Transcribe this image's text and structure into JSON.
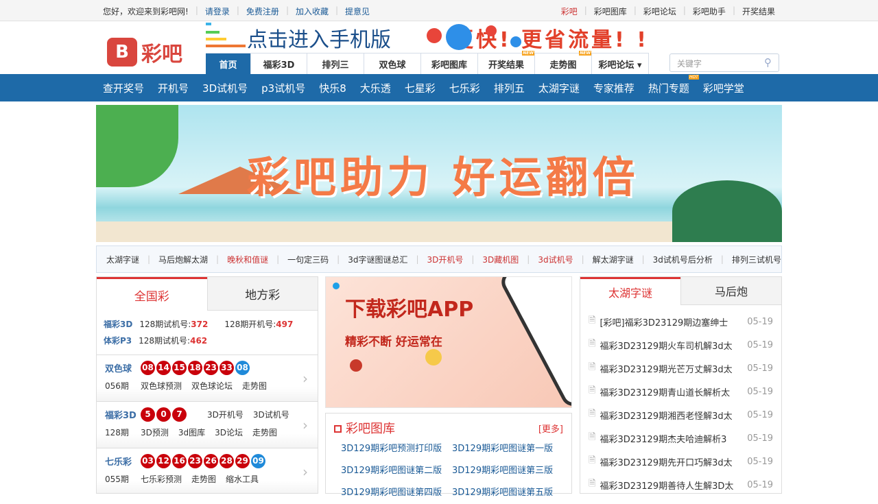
{
  "topbar": {
    "welcome": "您好，欢迎来到彩吧网!",
    "links": [
      "请登录",
      "免费注册",
      "加入收藏",
      "提意见"
    ],
    "right": [
      "彩吧",
      "彩吧图库",
      "彩吧论坛",
      "彩吧助手",
      "开奖结果"
    ]
  },
  "logo": {
    "mark": "B",
    "text": "彩吧"
  },
  "promo": {
    "a": "点击进入手机版",
    "b": "更快! 更省流量! !"
  },
  "mainnav": [
    {
      "label": "首页",
      "badge": ""
    },
    {
      "label": "福彩3D",
      "badge": ""
    },
    {
      "label": "排列三",
      "badge": ""
    },
    {
      "label": "双色球",
      "badge": ""
    },
    {
      "label": "彩吧图库",
      "badge": ""
    },
    {
      "label": "开奖结果",
      "badge": "NEW"
    },
    {
      "label": "走势图",
      "badge": "NEW"
    },
    {
      "label": "彩吧论坛 ▾",
      "badge": ""
    }
  ],
  "search": {
    "placeholder": "关键字"
  },
  "subnav": [
    "查开奖号",
    "开机号",
    "3D试机号",
    "p3试机号",
    "快乐8",
    "大乐透",
    "七星彩",
    "七乐彩",
    "排列五",
    "太湖字谜",
    "专家推荐",
    "热门专题",
    "彩吧学堂"
  ],
  "subnav_hot": "HOT",
  "banner": {
    "title": "彩吧助力  好运翻倍"
  },
  "quick": [
    {
      "t": "太湖字谜",
      "red": false
    },
    {
      "t": "马后炮解太湖",
      "red": false
    },
    {
      "t": "晚秋和值谜",
      "red": true
    },
    {
      "t": "一句定三码",
      "red": false
    },
    {
      "t": "3d字谜图谜总汇",
      "red": false
    },
    {
      "t": "3D开机号",
      "red": true
    },
    {
      "t": "3D藏机图",
      "red": true
    },
    {
      "t": "3d试机号",
      "red": true
    },
    {
      "t": "解太湖字谜",
      "red": false
    },
    {
      "t": "3d试机号后分析",
      "red": false
    },
    {
      "t": "排列三试机号",
      "red": false
    }
  ],
  "left": {
    "tabs": [
      "全国彩",
      "地方彩"
    ],
    "fc3d": {
      "name": "福彩3D",
      "a": "128期试机号:",
      "av": "372",
      "b": "128期开机号:",
      "bv": "497"
    },
    "p3": {
      "name": "体彩P3",
      "a": "128期试机号:",
      "av": "462"
    },
    "lots": [
      {
        "name": "双色球",
        "red": [
          "08",
          "14",
          "15",
          "18",
          "23",
          "33"
        ],
        "blue": [
          "08"
        ],
        "extra": [],
        "issue": "056期",
        "links": [
          "双色球预测",
          "双色球论坛",
          "走势图"
        ]
      },
      {
        "name": "福彩3D",
        "red": [
          "5",
          "0",
          "7"
        ],
        "blue": [],
        "extra": [
          "3D开机号",
          "3D试机号"
        ],
        "issue": "128期",
        "links": [
          "3D预测",
          "3d图库",
          "3D论坛",
          "走势图"
        ]
      },
      {
        "name": "七乐彩",
        "red": [
          "03",
          "12",
          "16",
          "23",
          "26",
          "28",
          "29"
        ],
        "blue": [
          "09"
        ],
        "extra": [],
        "issue": "055期",
        "links": [
          "七乐彩预测",
          "走势图",
          "缩水工具"
        ]
      }
    ]
  },
  "app": {
    "t1": "下载彩吧APP",
    "t2": "精彩不断 好运常在"
  },
  "gallery": {
    "title": "彩吧图库",
    "more": "[更多]",
    "items": [
      "3D129期彩吧预测打印版",
      "3D129期彩吧图谜第一版",
      "3D129期彩吧图谜第二版",
      "3D129期彩吧图谜第三版",
      "3D129期彩吧图谜第四版",
      "3D129期彩吧图谜第五版"
    ]
  },
  "right": {
    "tabs": [
      "太湖字谜",
      "马后炮"
    ],
    "news": [
      {
        "t": "[彩吧]福彩3D23129期边塞绅士",
        "d": "05-19"
      },
      {
        "t": "福彩3D23129期火车司机解3d太",
        "d": "05-19"
      },
      {
        "t": "福彩3D23129期光芒万丈解3d太",
        "d": "05-19"
      },
      {
        "t": "福彩3D23129期青山道长解析太",
        "d": "05-19"
      },
      {
        "t": "福彩3D23129期湘西老怪解3d太",
        "d": "05-19"
      },
      {
        "t": "福彩3D23129期杰夫哈迪解析3",
        "d": "05-19"
      },
      {
        "t": "福彩3D23129期先开口巧解3d太",
        "d": "05-19"
      },
      {
        "t": "福彩3D23129期善待人生解3D太",
        "d": "05-19"
      }
    ]
  }
}
